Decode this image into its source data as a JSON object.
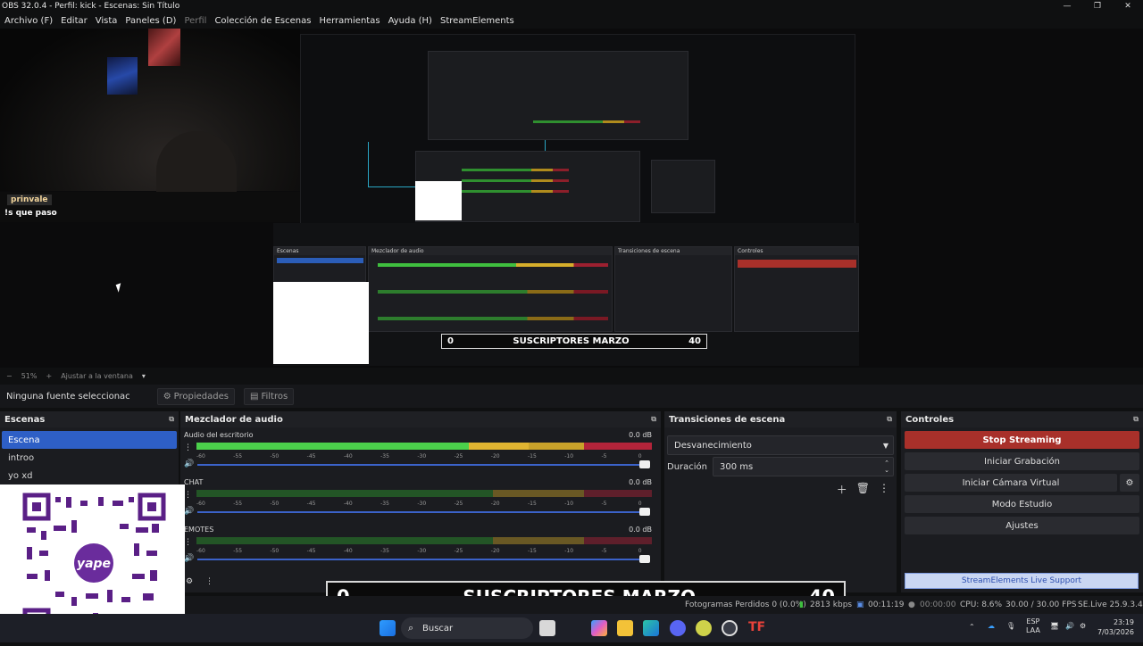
{
  "window": {
    "title": "OBS 32.0.4 - Perfil: kick - Escenas: Sin Título"
  },
  "menu": [
    "Archivo (F)",
    "Editar",
    "Vista",
    "Paneles (D)",
    "Perfil",
    "Colección de Escenas",
    "Herramientas",
    "Ayuda (H)",
    "StreamElements"
  ],
  "preview": {
    "chat_name": "prinvale",
    "chat_message": "!s que paso",
    "mini_counter": {
      "left": "0",
      "title": "SUSCRIPTORES MARZO",
      "right": "40"
    }
  },
  "zoom": {
    "minus": "−",
    "percent": "51%",
    "plus": "+",
    "fit_label": "Ajustar a la ventana"
  },
  "sourcebar": {
    "no_source": "Ninguna fuente seleccionac",
    "properties": "Propiedades",
    "filters": "Filtros"
  },
  "scenes": {
    "title": "Escenas",
    "items": [
      "Escena",
      "introo",
      "yo xd"
    ],
    "selected": 0
  },
  "mixer": {
    "title": "Mezclador de audio",
    "channels": [
      {
        "name": "Audio del escritorio",
        "db": "0.0 dB",
        "level": 0.73
      },
      {
        "name": "CHAT",
        "db": "0.0 dB",
        "level": 0.0
      },
      {
        "name": "EMOTES",
        "db": "0.0 dB",
        "level": 0.0
      }
    ],
    "ticks": [
      "-60",
      "-55",
      "-50",
      "-45",
      "-40",
      "-35",
      "-30",
      "-25",
      "-20",
      "-15",
      "-10",
      "-5",
      "0"
    ]
  },
  "transitions": {
    "title": "Transiciones de escena",
    "selected": "Desvanecimiento",
    "duration_label": "Duración",
    "duration_value": "300 ms"
  },
  "controls": {
    "title": "Controles",
    "stop_streaming": "Stop Streaming",
    "start_recording": "Iniciar Grabación",
    "virtual_camera": "Iniciar Cámara Virtual",
    "studio_mode": "Modo Estudio",
    "settings": "Ajustes",
    "se_support": "StreamElements Live Support"
  },
  "overlay_counter": {
    "left": "0",
    "title": "SUSCRIPTORES MARZO",
    "right": "40"
  },
  "status": {
    "frames_lost": "Fotogramas Perdidos 0 (0.0%)",
    "bitrate": "2813 kbps",
    "live_time": "00:11:19",
    "rec_time": "00:00:00",
    "cpu": "CPU: 8.6%",
    "fps": "30.00 / 30.00 FPS",
    "se_version": "SE.Live 25.9.3.493"
  },
  "taskbar": {
    "search": "Buscar",
    "lang": "ESP",
    "lang2": "LAA",
    "time": "23:19",
    "date": "7/03/2026"
  },
  "colors": {
    "accent": "#2e5fc6",
    "stop": "#a8302a",
    "meter_green": "#4bd04b",
    "meter_yellow": "#e0b431",
    "meter_red": "#c2283a"
  }
}
